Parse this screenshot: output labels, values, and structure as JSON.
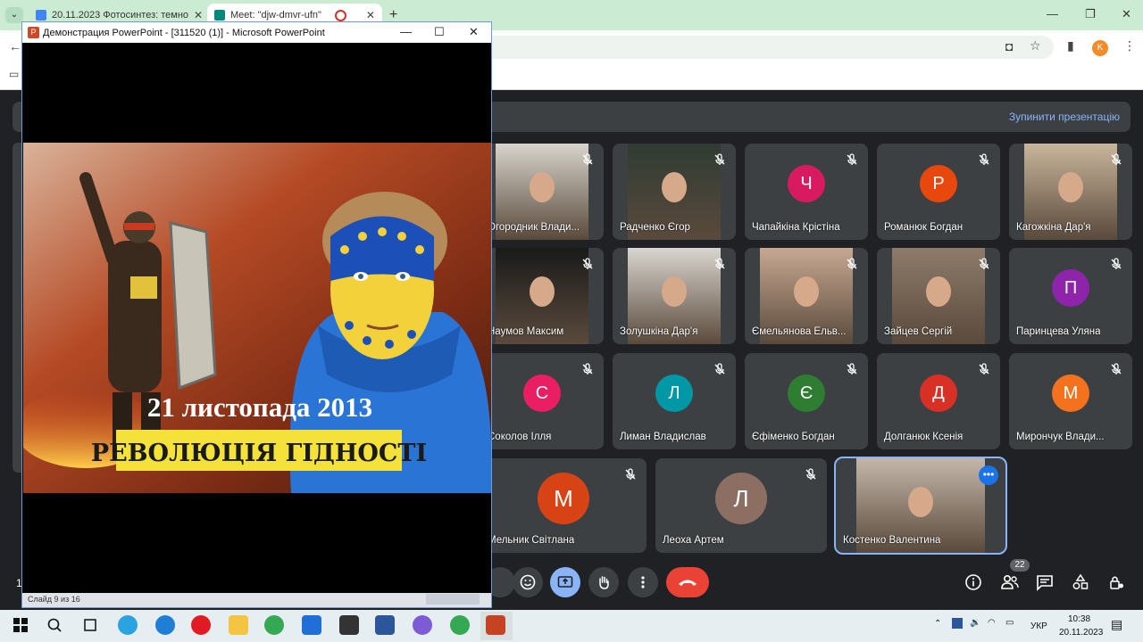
{
  "browser": {
    "tabs": [
      {
        "title": "20.11.2023 Фотосинтез: темно"
      },
      {
        "title": "Meet: \"djw-dmvr-ufn\""
      }
    ],
    "new_tab_label": "+",
    "profile_letter": "K"
  },
  "meet": {
    "stop_presenting_label": "Зупинити презентацію",
    "participant_count": "22",
    "participants": [
      {
        "name": "Огородник Влади...",
        "kind": "video"
      },
      {
        "name": "Радченко Єгор",
        "kind": "video"
      },
      {
        "name": "Чапайкіна Крістіна",
        "kind": "letter",
        "letter": "Ч",
        "color": "#d81b60"
      },
      {
        "name": "Романюк Богдан",
        "kind": "letter",
        "letter": "Р",
        "color": "#e8470e"
      },
      {
        "name": "Кагожкіна Дар'я",
        "kind": "video"
      },
      {
        "name": "Наумов Максим",
        "kind": "video"
      },
      {
        "name": "Золушкіна Дар'я",
        "kind": "video"
      },
      {
        "name": "Ємельянова Ельв...",
        "kind": "video"
      },
      {
        "name": "Зайцев Сергій",
        "kind": "video"
      },
      {
        "name": "Паринцева Уляна",
        "kind": "letter",
        "letter": "П",
        "color": "#8e24aa"
      },
      {
        "name": "Соколов Ілля",
        "kind": "letter",
        "letter": "С",
        "color": "#e91e63"
      },
      {
        "name": "Лиман Владислав",
        "kind": "letter",
        "letter": "Л",
        "color": "#0097a7"
      },
      {
        "name": "Єфіменко Богдан",
        "kind": "letter",
        "letter": "Є",
        "color": "#2e7d32"
      },
      {
        "name": "Долганюк Ксенія",
        "kind": "letter",
        "letter": "Д",
        "color": "#d93025"
      },
      {
        "name": "Мирончук Влади...",
        "kind": "letter",
        "letter": "М",
        "color": "#f4711e"
      },
      {
        "name": "Мельник Світлана",
        "kind": "letter",
        "letter": "М",
        "color": "#d84315"
      },
      {
        "name": "Леоха Артем",
        "kind": "letter",
        "letter": "Л",
        "color": "#8d6e63"
      },
      {
        "name": "Костенко Валентина",
        "kind": "video"
      }
    ],
    "time_fragment": "1"
  },
  "powerpoint": {
    "title": "Демонстрация PowerPoint - [311520 (1)] - Microsoft PowerPoint",
    "slide_status": "Слайд 9 из 16",
    "slide": {
      "date_text": "21 листопада 2013",
      "headline": "РЕВОЛЮЦІЯ ГІДНОСТІ"
    }
  },
  "taskbar": {
    "language": "УКР",
    "time": "10:38",
    "date": "20.11.2023"
  },
  "colors": {
    "chrome_tab_bg": "#ccebd3",
    "meet_bg": "#202124",
    "tile_bg": "#3c4043",
    "present_btn": "#8ab4f8",
    "hangup": "#ea4335"
  }
}
